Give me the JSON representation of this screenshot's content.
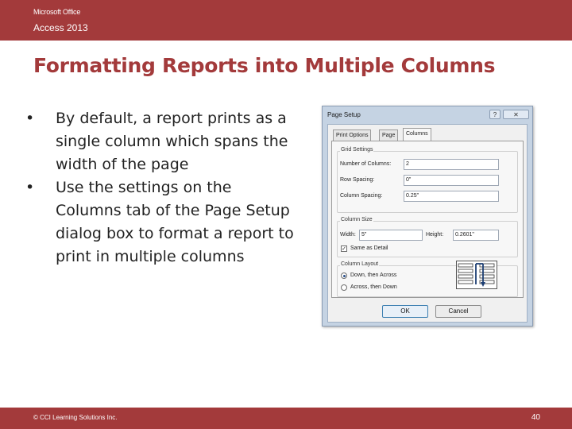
{
  "header": {
    "brand": "Microsoft Office",
    "product": "Access 2013"
  },
  "slide": {
    "title": "Formatting Reports into Multiple Columns",
    "bullet_symbol": "•",
    "bullets": [
      "By default, a report prints as a single column which spans the width of the page",
      "Use the settings on the Columns tab of the Page Setup dialog box to format a report to print in multiple columns"
    ]
  },
  "dialog": {
    "title": "Page Setup",
    "help_label": "?",
    "close_label": "✕",
    "tabs": [
      "Print Options",
      "Page",
      "Columns"
    ],
    "grid_settings": {
      "label": "Grid Settings",
      "number_of_columns_label": "Number of Columns:",
      "number_of_columns_value": "2",
      "row_spacing_label": "Row Spacing:",
      "row_spacing_value": "0\"",
      "column_spacing_label": "Column Spacing:",
      "column_spacing_value": "0.25\""
    },
    "column_size": {
      "label": "Column Size",
      "width_label": "Width:",
      "width_value": "5\"",
      "height_label": "Height:",
      "height_value": "0.2601\"",
      "same_as_detail_label": "Same as Detail",
      "same_as_detail_checked": "✓"
    },
    "column_layout": {
      "label": "Column Layout",
      "option_1": "Down, then Across",
      "option_2": "Across, then Down",
      "selected": "Down, then Across"
    },
    "ok_label": "OK",
    "cancel_label": "Cancel",
    "layout_icon": "down-then-across-layout-icon"
  },
  "footer": {
    "copyright": "© CCI Learning Solutions Inc.",
    "page_number": "40"
  },
  "colors": {
    "brand": "#a33a3b",
    "title": "#a33a3b",
    "dialog_frame": "#c5d3e3"
  }
}
